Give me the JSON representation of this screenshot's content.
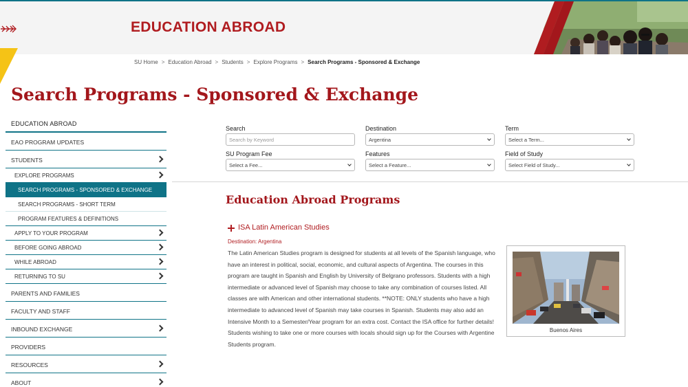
{
  "header": {
    "title": "EDUCATION ABROAD",
    "accent_red": "#b01c20",
    "accent_teal": "#0f7387",
    "accent_yellow": "#f5c316"
  },
  "breadcrumb": {
    "items": [
      "SU Home",
      "Education Abroad",
      "Students",
      "Explore Programs"
    ],
    "current": "Search Programs - Sponsored & Exchange",
    "separator": ">"
  },
  "page_title": "Search Programs - Sponsored & Exchange",
  "sidebar": {
    "heading": "EDUCATION ABROAD",
    "items": [
      {
        "label": "EAO Program Updates"
      },
      {
        "label": "Students"
      },
      {
        "label": "Explore Programs"
      },
      {
        "label": "Search Programs - Sponsored & Exchange"
      },
      {
        "label": "Search Programs - Short Term"
      },
      {
        "label": "Program Features & Definitions"
      },
      {
        "label": "Apply to Your Program"
      },
      {
        "label": "Before Going Abroad"
      },
      {
        "label": "While Abroad"
      },
      {
        "label": "Returning to SU"
      },
      {
        "label": "Parents and Families"
      },
      {
        "label": "Faculty and Staff"
      },
      {
        "label": "Inbound Exchange"
      },
      {
        "label": "Providers"
      },
      {
        "label": "Resources"
      },
      {
        "label": "About"
      }
    ]
  },
  "filters": {
    "search": {
      "label": "Search",
      "placeholder": "Search by Keyword"
    },
    "destination": {
      "label": "Destination",
      "value": "Argentina"
    },
    "term": {
      "label": "Term",
      "value": "Select a Term..."
    },
    "fee": {
      "label": "SU Program Fee",
      "value": "Select a Fee..."
    },
    "features": {
      "label": "Features",
      "value": "Select a Feature..."
    },
    "field": {
      "label": "Field of Study",
      "value": "Select Field of Study..."
    }
  },
  "results": {
    "title": "Education Abroad Programs",
    "program": {
      "name": "ISA Latin American Studies",
      "destination": "Destination: Argentina",
      "description": "The Latin American Studies program is designed for students at all levels of the Spanish language, who have an interest in political, social, economic, and cultural aspects of Argentina. The courses in this program are taught in Spanish and English by University of Belgrano professors. Students with a high intermediate or advanced level of Spanish may choose to take any combination of courses listed. All classes are with American and other international students. **NOTE: ONLY students who have a high intermediate to advanced level of Spanish may take courses in Spanish. Students may also add an Intensive Month to a Semester/Year program for an extra cost. Contact the ISA office for further details! Students wishing to take one or more courses with locals should sign up for the Courses with Argentine Students program.",
      "image_caption": "Buenos Aires"
    }
  }
}
